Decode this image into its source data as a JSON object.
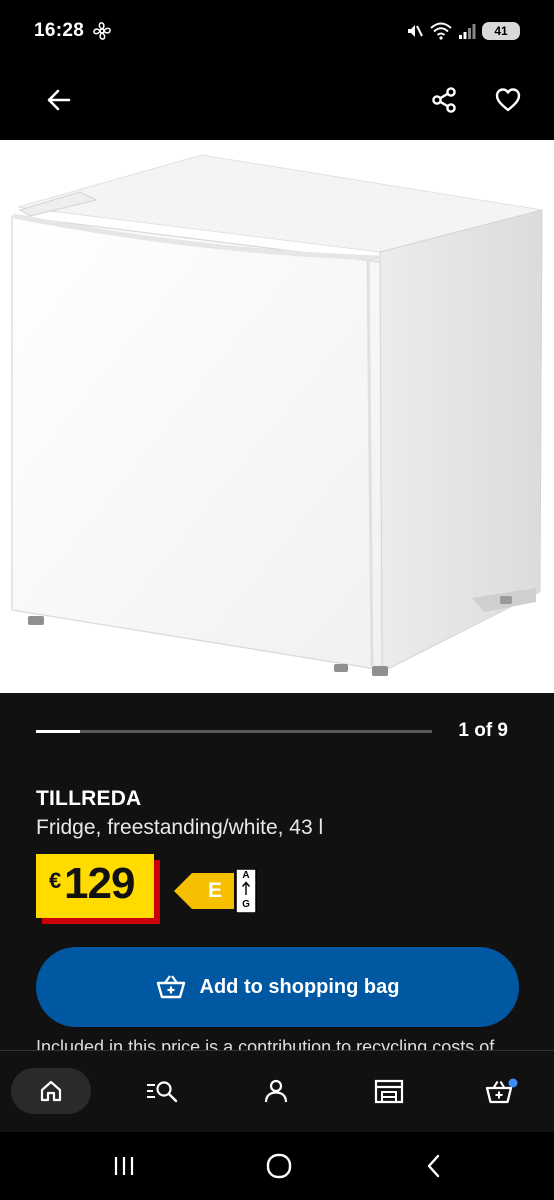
{
  "status_bar": {
    "time": "16:28",
    "battery_level": "41"
  },
  "product": {
    "name": "TILLREDA",
    "description": "Fridge, freestanding/white, 43 l",
    "currency_symbol": "€",
    "price": "129",
    "energy_class": "E",
    "energy_scale_top": "A",
    "energy_scale_bottom": "G"
  },
  "gallery": {
    "counter": "1 of 9",
    "current_image": 1,
    "total_images": 9
  },
  "actions": {
    "add_to_bag_label": "Add to shopping bag"
  },
  "info_text": "Included in this price is a contribution to recycling costs of",
  "colors": {
    "price_tag_bg": "#ffdb00",
    "price_tag_shadow": "#cc0008",
    "button_blue": "#0058a3",
    "energy_label_yellow": "#f6c000",
    "page_bg": "#111111"
  },
  "icons": {
    "header": [
      "back-arrow-icon",
      "share-icon",
      "heart-icon"
    ],
    "bottom_nav": [
      "home-icon",
      "search-list-icon",
      "profile-icon",
      "store-icon",
      "shopping-bag-icon"
    ],
    "system_nav": [
      "recents-icon",
      "home-circle-icon",
      "back-chevron-icon"
    ]
  }
}
